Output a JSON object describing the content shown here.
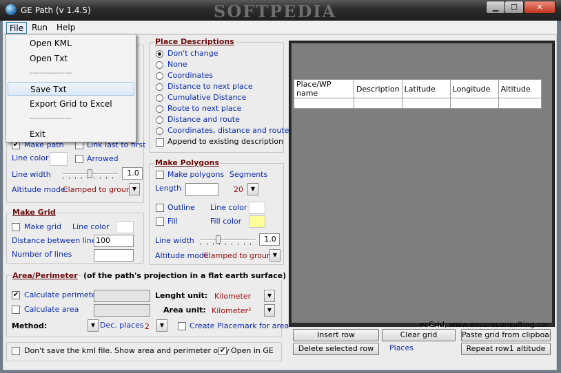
{
  "window": {
    "title": "GE Path (v 1.4.5)",
    "watermark": "SOFTPEDIA",
    "minimize_label": "▁",
    "maximize_label": "☐",
    "close_label": "✕"
  },
  "menubar": {
    "items": [
      "File",
      "Run",
      "Help"
    ]
  },
  "file_menu": {
    "items": [
      "Open KML",
      "Open Txt",
      "-----------------",
      "Save Txt",
      "Export Grid to Excel",
      "-----------------",
      "Exit"
    ]
  },
  "path": {
    "make_path": {
      "label": "Make path",
      "checked": true
    },
    "link_last_first": {
      "label": "Link last to first",
      "checked": false
    },
    "line_color_label": "Line color",
    "arrowed": {
      "label": "Arrowed",
      "checked": false
    },
    "line_width_label": "Line width",
    "line_width_value": "1.0",
    "altitude_mode_label": "Altitude mode:",
    "altitude_mode_value": "Clamped to ground"
  },
  "place_descriptions": {
    "title": "Place Descriptions",
    "options": [
      "Don't change",
      "None",
      "Coordinates",
      "Distance to next place",
      "Cumulative Distance",
      "Route to next place",
      "Distance and route",
      "Coordinates, distance and route"
    ],
    "selected_index": 0,
    "append": {
      "label": "Append to existing description",
      "checked": false
    }
  },
  "make_polygons": {
    "title": "Make Polygons",
    "make": {
      "label": "Make polygons",
      "checked": false
    },
    "segments_label": "Segments",
    "segments_value": "20",
    "length_label": "Length",
    "length_value": "",
    "outline": {
      "label": "Outline",
      "checked": false
    },
    "line_color_label": "Line color",
    "fill": {
      "label": "Fill",
      "checked": false
    },
    "fill_color_label": "Fill color",
    "fill_color": "#ffff99",
    "line_width_label": "Line width",
    "line_width_value": "1.0",
    "altitude_mode_label": "Altitude mode:",
    "altitude_mode_value": "Clamped to ground"
  },
  "make_grid": {
    "title": "Make Grid",
    "make": {
      "label": "Make grid",
      "checked": false
    },
    "line_color_label": "Line color",
    "distance_label": "Distance between lines",
    "distance_value": "100",
    "number_label": "Number of  lines",
    "number_value": ""
  },
  "area": {
    "title": "Area/Perimeter",
    "subtitle": "(of the path's projection in a flat earth surface)",
    "calc_perimeter": {
      "label": "Calculate perimeter",
      "checked": true
    },
    "length_unit_label": "Lenght unit:",
    "length_unit_value": "Kilometer",
    "calc_area": {
      "label": "Calculate area",
      "checked": false
    },
    "area_unit_label": "Area unit:",
    "area_unit_value": "Kilometer²",
    "method_label": "Method:",
    "dec_places_label": "Dec. places",
    "dec_places_value": "2",
    "create_placemark": {
      "label": "Create Placemark for area",
      "checked": false
    }
  },
  "bottom": {
    "dont_save": {
      "label": "Don't save the kml file. Show area and perimeter only",
      "checked": false
    },
    "open_in_ge": {
      "label": "Open in GE",
      "checked": true
    }
  },
  "grid": {
    "columns": [
      "Place/WP name",
      "Description",
      "Latitude",
      "Longitude",
      "Altitude"
    ],
    "footer": "ecGrid,  www.encoreconsulting.com.au",
    "buttons": {
      "insert_row": "Insert row",
      "clear_grid": "Clear grid",
      "paste_grid": "Paste grid from clipboard",
      "delete_row": "Delete selected row",
      "places": "Places",
      "repeat_row": "Repeat row1 altitude"
    }
  }
}
